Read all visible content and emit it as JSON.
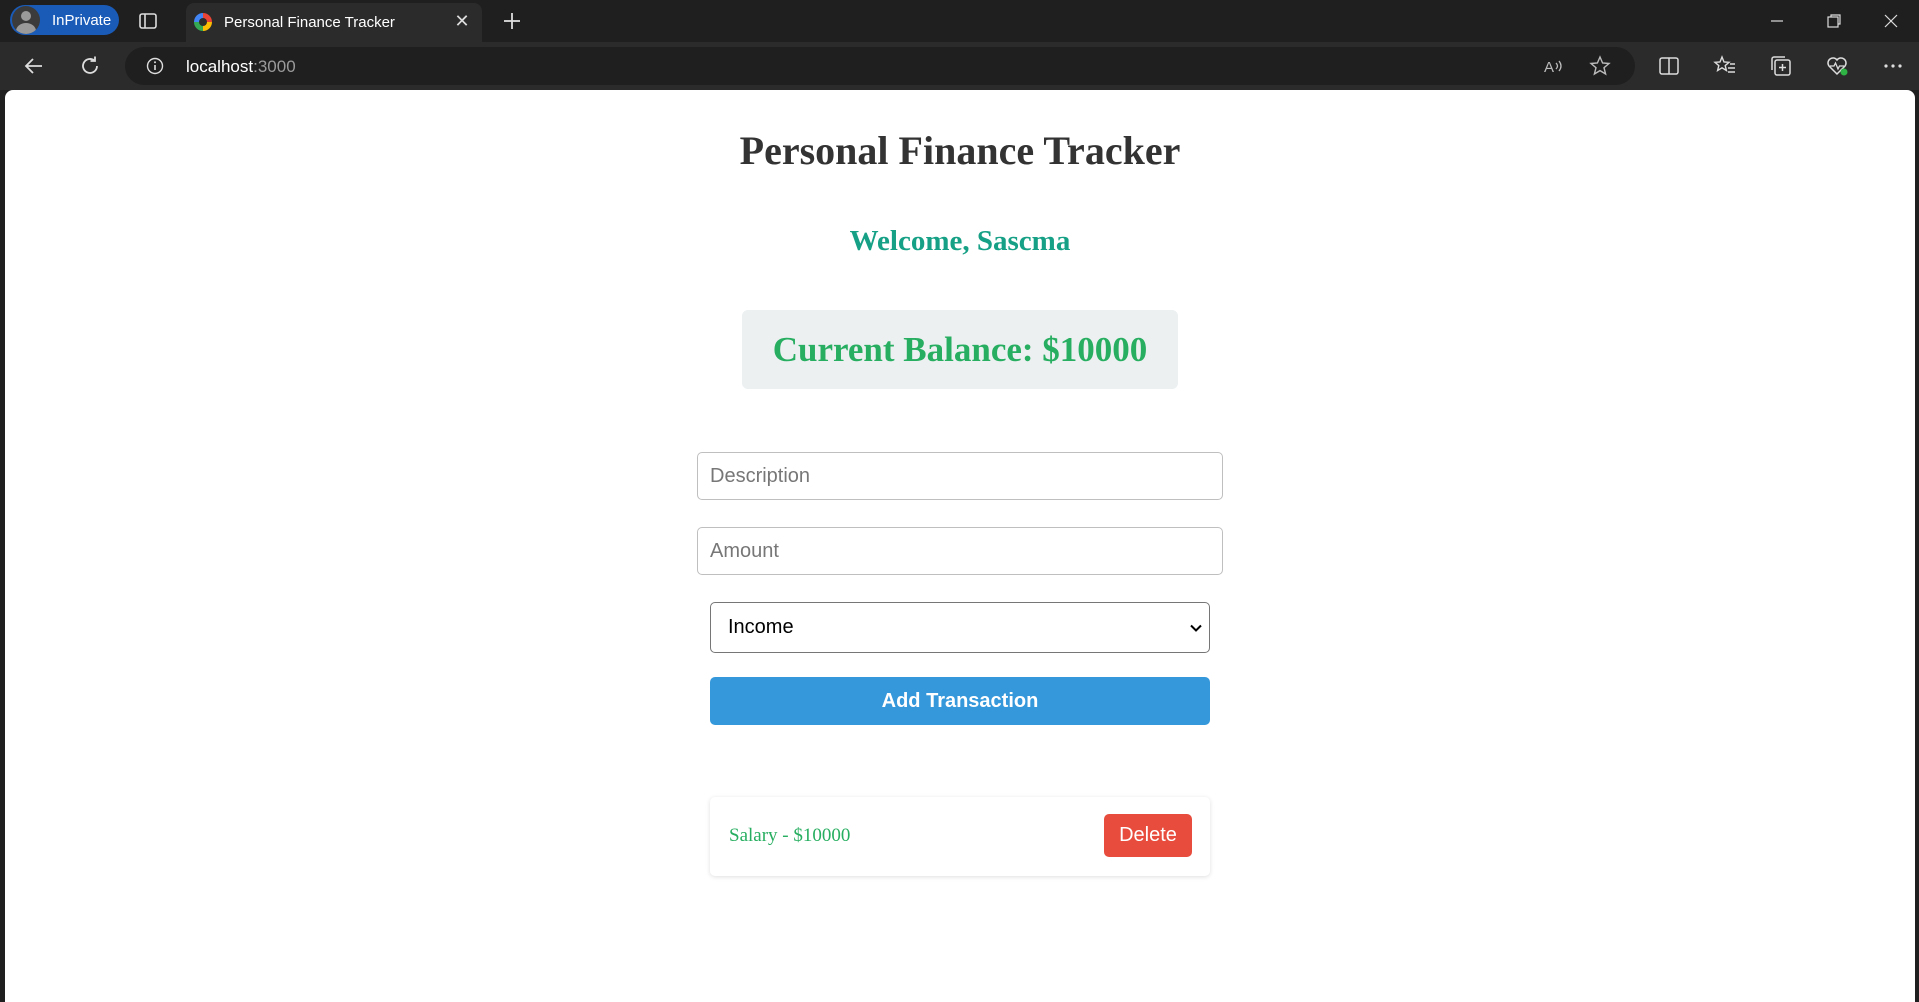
{
  "browser": {
    "profile_label": "InPrivate",
    "tab_title": "Personal Finance Tracker",
    "url_host": "localhost",
    "url_port": ":3000"
  },
  "page": {
    "title": "Personal Finance Tracker",
    "welcome": "Welcome, Sascma",
    "balance": "Current Balance: $10000",
    "form": {
      "description_placeholder": "Description",
      "amount_placeholder": "Amount",
      "type_selected": "Income",
      "submit_label": "Add Transaction"
    },
    "transactions": [
      {
        "text": "Salary - $10000",
        "delete_label": "Delete"
      }
    ]
  },
  "colors": {
    "accent_blue": "#3498db",
    "income_green": "#27ae60",
    "welcome_teal": "#16a085",
    "delete_red": "#e74c3c"
  }
}
